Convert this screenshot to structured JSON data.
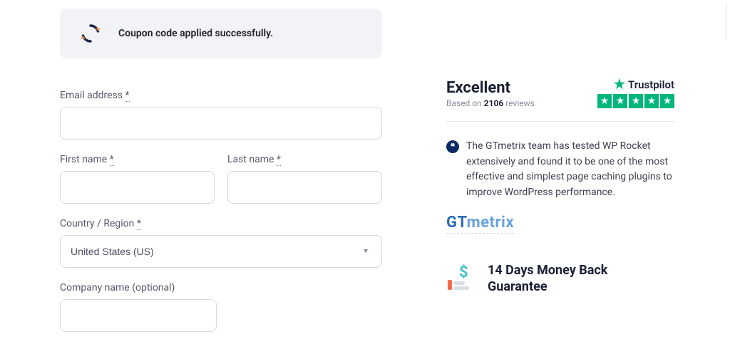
{
  "notice": {
    "message": "Coupon code applied successfully."
  },
  "form": {
    "email_label": "Email address ",
    "first_name_label": "First name ",
    "last_name_label": "Last name ",
    "country_label": "Country / Region ",
    "country_value": "United States (US)",
    "company_label": "Company name (optional)",
    "required_mark": "*"
  },
  "trust": {
    "rating_word": "Excellent",
    "based_prefix": "Based on ",
    "review_count": "2106",
    "based_suffix": " reviews",
    "brand": "Trustpilot"
  },
  "testimonial": {
    "text": "The GTmetrix team has tested WP Rocket extensively and found it to be one of the most effective and simplest page caching plugins to improve WordPress performance.",
    "source_gt": "GT",
    "source_metrix": "metrix"
  },
  "guarantee": {
    "line1": "14 Days Money Back",
    "line2": "Guarantee"
  }
}
